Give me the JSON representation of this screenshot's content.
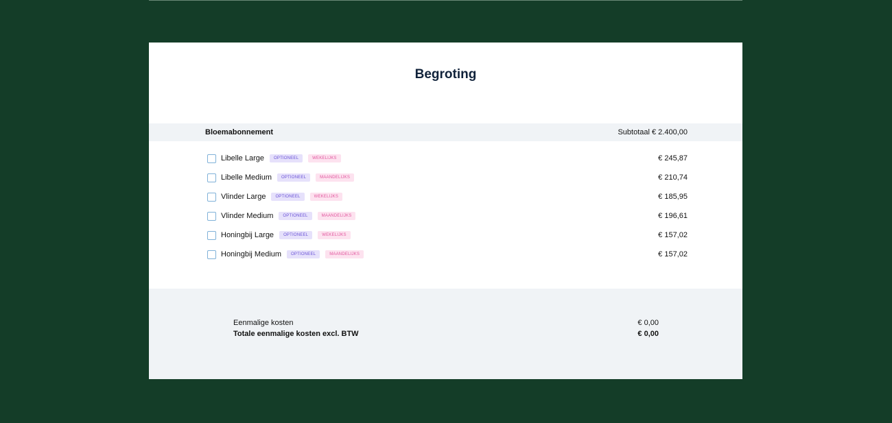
{
  "page": {
    "title": "Begroting"
  },
  "group": {
    "name": "Bloemabonnement",
    "subtotal": "Subtotaal € 2.400,00"
  },
  "items": [
    {
      "name": "Libelle Large",
      "tag_optional": "OPTIONEEL",
      "tag_frequency": "WEKELIJKS",
      "price": "€ 245,87"
    },
    {
      "name": "Libelle Medium",
      "tag_optional": "OPTIONEEL",
      "tag_frequency": "MAANDELIJKS",
      "price": "€ 210,74"
    },
    {
      "name": "Vlinder Large",
      "tag_optional": "OPTIONEEL",
      "tag_frequency": "WEKELIJKS",
      "price": "€ 185,95"
    },
    {
      "name": "Vlinder Medium",
      "tag_optional": "OPTIONEEL",
      "tag_frequency": "MAANDELIJKS",
      "price": "€ 196,61"
    },
    {
      "name": "Honingbij Large",
      "tag_optional": "OPTIONEEL",
      "tag_frequency": "WEKELIJKS",
      "price": "€ 157,02"
    },
    {
      "name": "Honingbij Medium",
      "tag_optional": "OPTIONEEL",
      "tag_frequency": "MAANDELIJKS",
      "price": "€ 157,02"
    }
  ],
  "summary": {
    "onetime_label": "Eenmalige kosten",
    "onetime_value": "€ 0,00",
    "total_label": "Totale eenmalige kosten excl. BTW",
    "total_value": "€ 0,00"
  },
  "colors": {
    "background": "#143d28",
    "card": "#ffffff",
    "section_bg": "#f0f3f6",
    "tag_optional_bg": "#e6e1fb",
    "tag_optional_text": "#6a52d6",
    "tag_frequency_bg": "#fde2ef",
    "tag_frequency_text": "#e0559d",
    "checkbox_border": "#7fb1d8"
  }
}
